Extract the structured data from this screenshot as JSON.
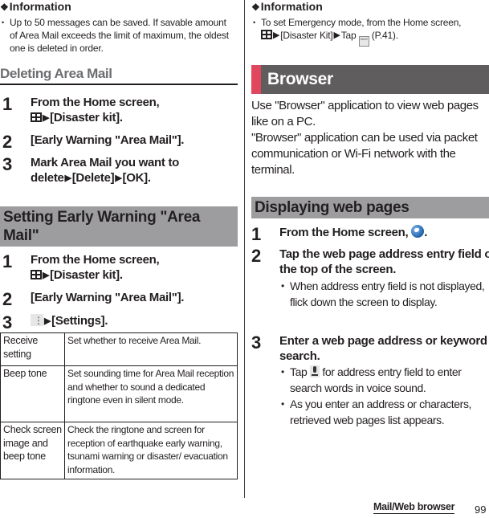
{
  "left": {
    "info": {
      "heading": "Information",
      "bullets": [
        "Up to 50 messages can be saved. If savable amount of Area Mail exceeds the limit of maximum, the oldest one is deleted in order."
      ]
    },
    "deleting": {
      "title": "Deleting Area Mail",
      "steps": [
        {
          "num": "1",
          "line1": "From the Home screen,",
          "line2": "[Disaster kit]."
        },
        {
          "num": "2",
          "text": "[Early Warning \"Area Mail\"]."
        },
        {
          "num": "3",
          "line1": "Mark Area Mail you want to",
          "line2a": "delete",
          "line2b": "[Delete]",
          "line2c": "[OK]."
        }
      ]
    },
    "setting": {
      "title": "Setting Early Warning \"Area Mail\"",
      "steps": [
        {
          "num": "1",
          "line1": "From the Home screen,",
          "line2": "[Disaster kit]."
        },
        {
          "num": "2",
          "text": "[Early Warning \"Area Mail\"]."
        },
        {
          "num": "3",
          "text": "[Settings]."
        }
      ],
      "table": [
        {
          "key": "Receive setting",
          "value": "Set whether to receive Area Mail."
        },
        {
          "key": "Beep tone",
          "value": "Set sounding time for Area Mail reception and whether to sound a dedicated ringtone even in silent mode."
        },
        {
          "key": "Check screen image and beep tone",
          "value": "Check the ringtone and screen for reception of earthquake early warning, tsunami warning or disaster/ evacuation information."
        }
      ]
    }
  },
  "right": {
    "info": {
      "heading": "Information",
      "bullet_a": "To set Emergency mode, from the Home screen,",
      "bullet_b": "[Disaster Kit]",
      "bullet_c": "Tap",
      "bullet_d": "(P.41)."
    },
    "browser": {
      "title": "Browser",
      "intro1": "Use \"Browser\" application to view web pages like on a PC.",
      "intro2": "\"Browser\" application can be used via packet communication or Wi-Fi network with the terminal."
    },
    "displaying": {
      "title": "Displaying web pages",
      "steps": [
        {
          "num": "1",
          "text": "From the Home screen,"
        },
        {
          "num": "2",
          "text": "Tap the web page address entry field on the top of the screen.",
          "bullets": [
            "When address entry field is not displayed, flick down the screen to display."
          ]
        },
        {
          "num": "3",
          "text": "Enter a web page address or keyword to search.",
          "bullet1_a": "Tap",
          "bullet1_b": "for address entry field to enter search words in voice sound.",
          "bullet2": "As you enter an address or characters, retrieved web pages list appears."
        }
      ]
    }
  },
  "footer": {
    "section": "Mail/Web browser",
    "page": "99"
  },
  "colors": {
    "accent_red": "#e0475f",
    "banner_dark": "#5f5d5e",
    "banner_grey": "#9d9d9f",
    "section_grey_text": "#6d6e70"
  }
}
